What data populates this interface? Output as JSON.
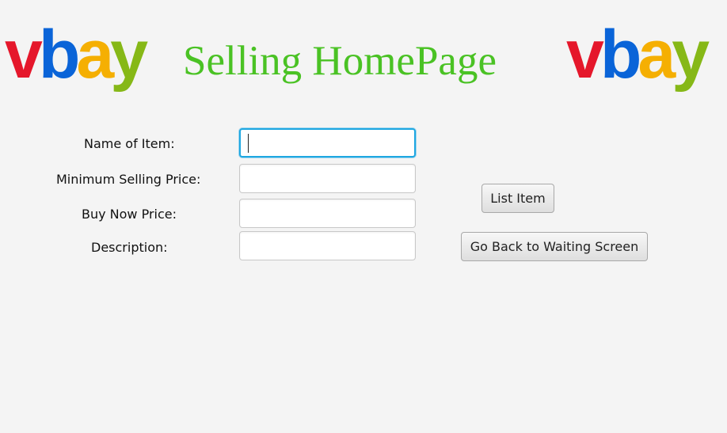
{
  "logo": {
    "letters": [
      "v",
      "b",
      "a",
      "y"
    ],
    "colors": {
      "v": "#e5172b",
      "b": "#0a64d8",
      "a": "#f5af02",
      "y": "#86b817"
    }
  },
  "header": {
    "title": "Selling HomePage",
    "title_color": "#4ac224"
  },
  "form": {
    "fields": [
      {
        "label": "Name of Item:",
        "value": "",
        "focused": true
      },
      {
        "label": "Minimum Selling Price:",
        "value": ""
      },
      {
        "label": "Buy Now Price:",
        "value": ""
      },
      {
        "label": "Description:",
        "value": ""
      }
    ]
  },
  "actions": {
    "list_item_label": "List Item",
    "go_back_label": "Go Back to Waiting Screen"
  },
  "colors": {
    "background": "#f4f4f4",
    "focus_ring": "#1fa7e1"
  }
}
